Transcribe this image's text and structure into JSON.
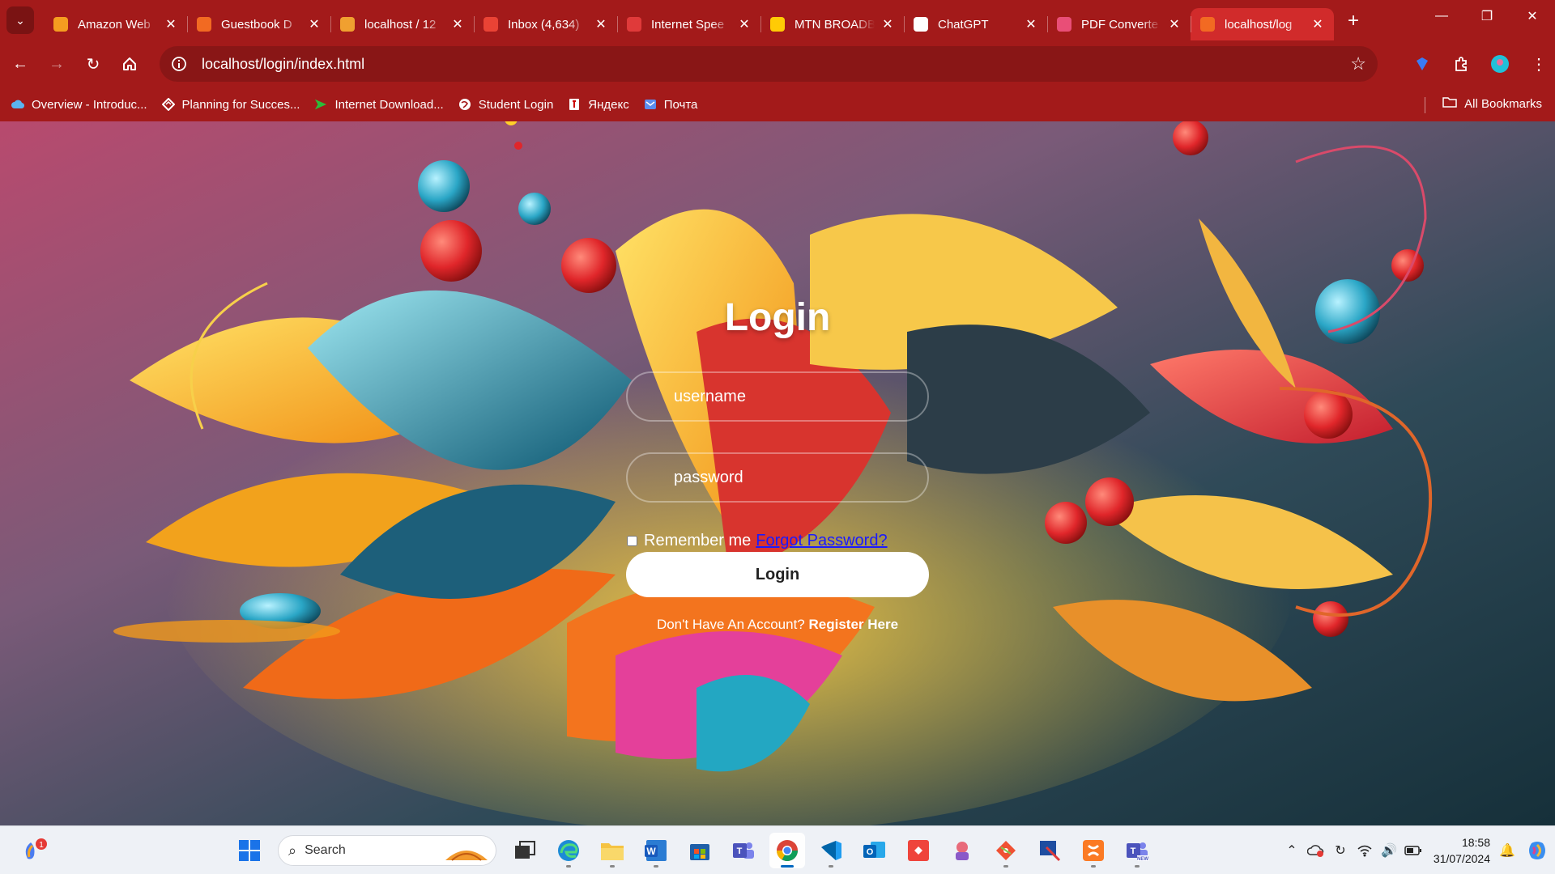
{
  "browser": {
    "tabs": [
      {
        "title": "Amazon Web",
        "favicon": "amazon-icon",
        "color": "#f59d20",
        "active": false
      },
      {
        "title": "Guestbook D",
        "favicon": "xampp-icon",
        "color": "#f26a22",
        "active": false
      },
      {
        "title": "localhost / 12",
        "favicon": "phpmyadmin-icon",
        "color": "#f0a030",
        "active": false
      },
      {
        "title": "Inbox (4,634)",
        "favicon": "gmail-icon",
        "color": "#ea4335",
        "active": false
      },
      {
        "title": "Internet Spee",
        "favicon": "speedtest-icon",
        "color": "#e03a3a",
        "active": false
      },
      {
        "title": "MTN BROADB",
        "favicon": "mtn-icon",
        "color": "#ffcb05",
        "active": false
      },
      {
        "title": "ChatGPT",
        "favicon": "chatgpt-icon",
        "color": "#ffffff",
        "active": false
      },
      {
        "title": "PDF Converte",
        "favicon": "pdf-converter-icon",
        "color": "#e94e77",
        "active": false
      },
      {
        "title": "localhost/log",
        "favicon": "xampp-icon",
        "color": "#f26a22",
        "active": true
      }
    ],
    "url": "localhost/login/index.html",
    "bookmarks": [
      {
        "label": "Overview - Introduc...",
        "icon": "azure-cloud-icon"
      },
      {
        "label": "Planning for Succes...",
        "icon": "diamond-icon"
      },
      {
        "label": "Internet Download...",
        "icon": "idm-arrow-icon"
      },
      {
        "label": "Student Login",
        "icon": "globe-icon"
      },
      {
        "label": "Яндекс",
        "icon": "yandex-icon"
      },
      {
        "label": "Почта",
        "icon": "mail-icon"
      }
    ],
    "all_bookmarks_label": "All Bookmarks"
  },
  "login": {
    "title": "Login",
    "username_placeholder": "username",
    "password_placeholder": "password",
    "remember_label": "Remember me",
    "forgot_link": "Forgot Password?",
    "button_label": "Login",
    "register_prompt": "Don't Have An Account?",
    "register_link": "Register Here"
  },
  "taskbar": {
    "search_placeholder": "Search",
    "notification_count": "1",
    "apps": [
      "start-icon",
      "task-view-icon",
      "edge-icon",
      "file-explorer-icon",
      "word-icon",
      "store-icon",
      "teams-icon",
      "chrome-icon",
      "vscode-icon",
      "outlook-icon",
      "anydesk-icon",
      "game-icon",
      "git-icon",
      "snipping-icon",
      "xampp-icon",
      "teams-new-icon"
    ],
    "time": "18:58",
    "date": "31/07/2024"
  },
  "colors": {
    "browser_frame": "#a31a1a",
    "omnibox": "#891616",
    "active_tab": "#d12b2b",
    "link_blue": "#1a1aff"
  }
}
